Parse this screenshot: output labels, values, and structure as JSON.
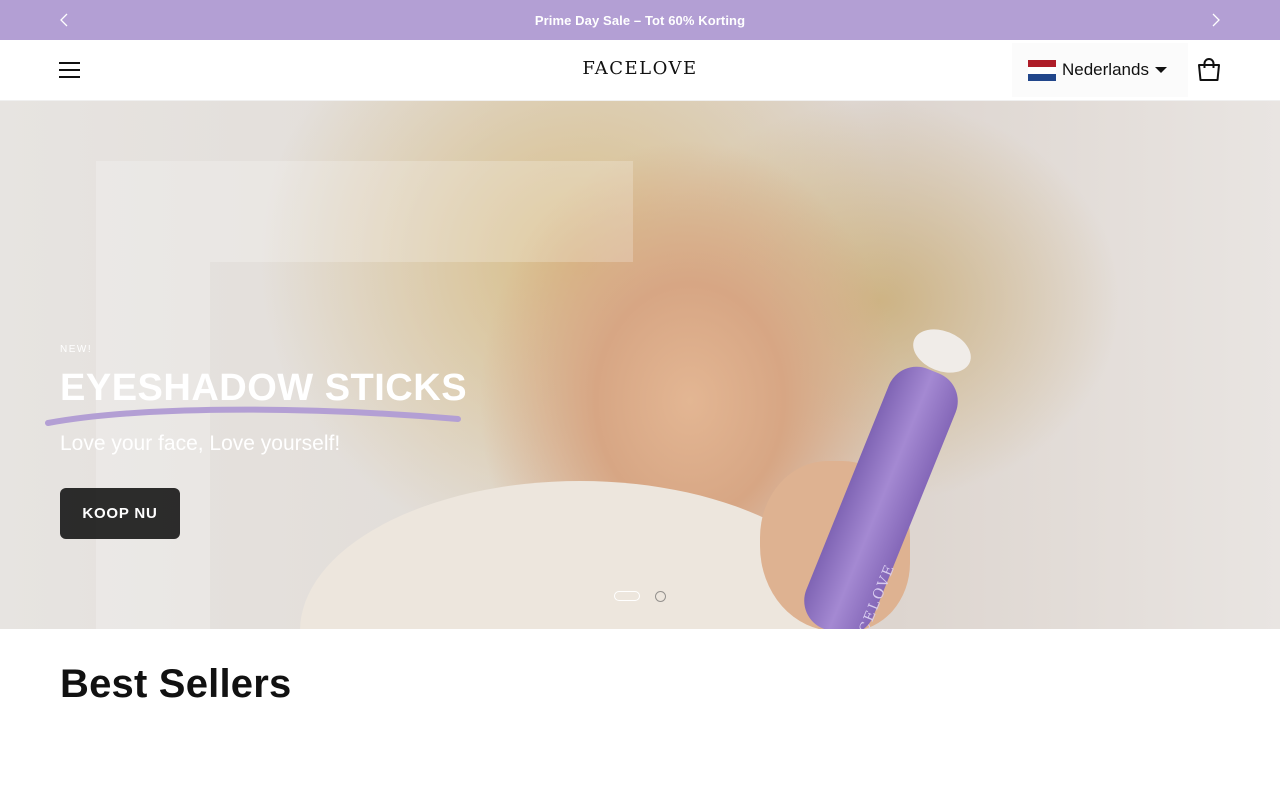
{
  "announcement": {
    "text": "Prime Day Sale – Tot 60% Korting",
    "prev_icon": "chevron-left-icon",
    "next_icon": "chevron-right-icon"
  },
  "header": {
    "menu_icon": "hamburger-menu-icon",
    "logo": "FACELOVE",
    "language": {
      "label": "Nederlands",
      "flag": "netherlands-flag-icon",
      "flag_colors": [
        "#ae1c28",
        "#ffffff",
        "#21468b"
      ]
    },
    "cart_icon": "shopping-bag-icon"
  },
  "hero": {
    "eyebrow": "NEW!",
    "title": "EYESHADOW STICKS",
    "subtitle": "Love your face, Love yourself!",
    "cta": "KOOP NU",
    "product_brand": "FACELOVE",
    "slide_dots": {
      "count": 2,
      "active": 1
    },
    "underline_color": "#b39fd4"
  },
  "sections": {
    "best_sellers_title": "Best Sellers"
  },
  "colors": {
    "accent": "#b39fd4",
    "text": "#111111",
    "background": "#ffffff"
  }
}
